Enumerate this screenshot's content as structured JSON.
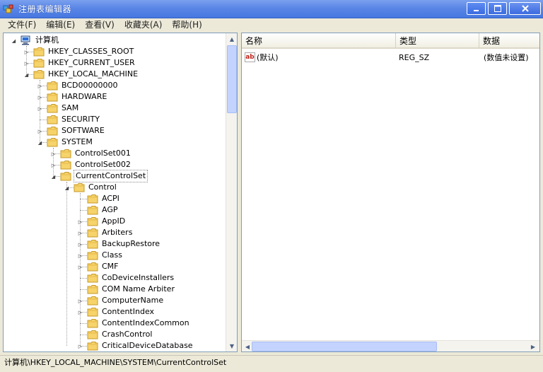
{
  "window": {
    "title": "注册表编辑器",
    "accent": "#4677df"
  },
  "menu": [
    "文件(F)",
    "编辑(E)",
    "查看(V)",
    "收藏夹(A)",
    "帮助(H)"
  ],
  "tree": {
    "root": "计算机",
    "nodes": [
      {
        "label": "HKEY_CLASSES_ROOT",
        "expander": "collapsed"
      },
      {
        "label": "HKEY_CURRENT_USER",
        "expander": "collapsed"
      },
      {
        "label": "HKEY_LOCAL_MACHINE",
        "expander": "expanded"
      },
      {
        "label": "BCD00000000",
        "expander": "collapsed"
      },
      {
        "label": "HARDWARE",
        "expander": "collapsed"
      },
      {
        "label": "SAM",
        "expander": "collapsed"
      },
      {
        "label": "SECURITY",
        "expander": "none"
      },
      {
        "label": "SOFTWARE",
        "expander": "collapsed"
      },
      {
        "label": "SYSTEM",
        "expander": "expanded"
      },
      {
        "label": "ControlSet001",
        "expander": "collapsed"
      },
      {
        "label": "ControlSet002",
        "expander": "collapsed"
      },
      {
        "label": "CurrentControlSet",
        "expander": "expanded",
        "selected": true
      },
      {
        "label": "Control",
        "expander": "expanded"
      },
      {
        "label": "ACPI",
        "expander": "none"
      },
      {
        "label": "AGP",
        "expander": "none"
      },
      {
        "label": "AppID",
        "expander": "collapsed"
      },
      {
        "label": "Arbiters",
        "expander": "collapsed"
      },
      {
        "label": "BackupRestore",
        "expander": "collapsed"
      },
      {
        "label": "Class",
        "expander": "collapsed"
      },
      {
        "label": "CMF",
        "expander": "collapsed"
      },
      {
        "label": "CoDeviceInstallers",
        "expander": "none"
      },
      {
        "label": "COM Name Arbiter",
        "expander": "none"
      },
      {
        "label": "ComputerName",
        "expander": "collapsed"
      },
      {
        "label": "ContentIndex",
        "expander": "collapsed"
      },
      {
        "label": "ContentIndexCommon",
        "expander": "none"
      },
      {
        "label": "CrashControl",
        "expander": "none"
      },
      {
        "label": "CriticalDeviceDatabase",
        "expander": "collapsed"
      }
    ]
  },
  "list": {
    "columns": [
      "名称",
      "类型",
      "数据"
    ],
    "rows": [
      {
        "name": "(默认)",
        "type": "REG_SZ",
        "data": "(数值未设置)"
      }
    ]
  },
  "status": "计算机\\HKEY_LOCAL_MACHINE\\SYSTEM\\CurrentControlSet"
}
